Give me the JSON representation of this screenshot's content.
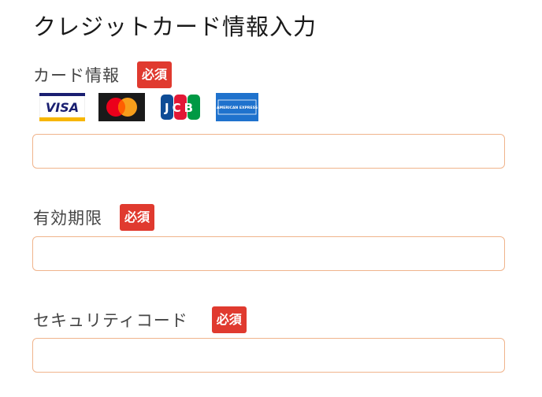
{
  "page": {
    "title": "クレジットカード情報入力"
  },
  "required_badge": "必須",
  "card_info": {
    "label": "カード情報",
    "value": "",
    "brands": [
      {
        "name": "visa",
        "text": "VISA",
        "color": "#1a1f71",
        "accent": "#f7b600"
      },
      {
        "name": "mastercard",
        "color": "#eb001b",
        "accent": "#f79e1b"
      },
      {
        "name": "jcb",
        "text": "JCB",
        "colors": [
          "#0e4c96",
          "#e21836",
          "#009944"
        ]
      },
      {
        "name": "american-express",
        "text": "AMERICAN EXPRESS",
        "color": "#1f72cd"
      }
    ]
  },
  "expiry": {
    "label": "有効期限",
    "value": ""
  },
  "security_code": {
    "label": "セキュリティコード",
    "value": ""
  },
  "colors": {
    "badge": "#e03a2f",
    "input_border": "#f0b48c"
  }
}
